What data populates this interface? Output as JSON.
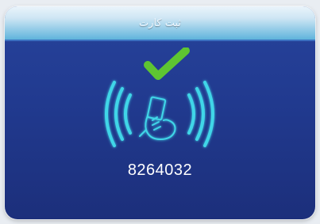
{
  "header": {
    "title": "ثبت کارت"
  },
  "status": {
    "icon": "checkmark-icon",
    "nfc_icon": "nfc-tap-icon",
    "card_number": "8264032"
  },
  "colors": {
    "accent_green": "#5ec532",
    "nfc_glow": "#3fd6e8",
    "screen_blue": "#213a8f"
  }
}
